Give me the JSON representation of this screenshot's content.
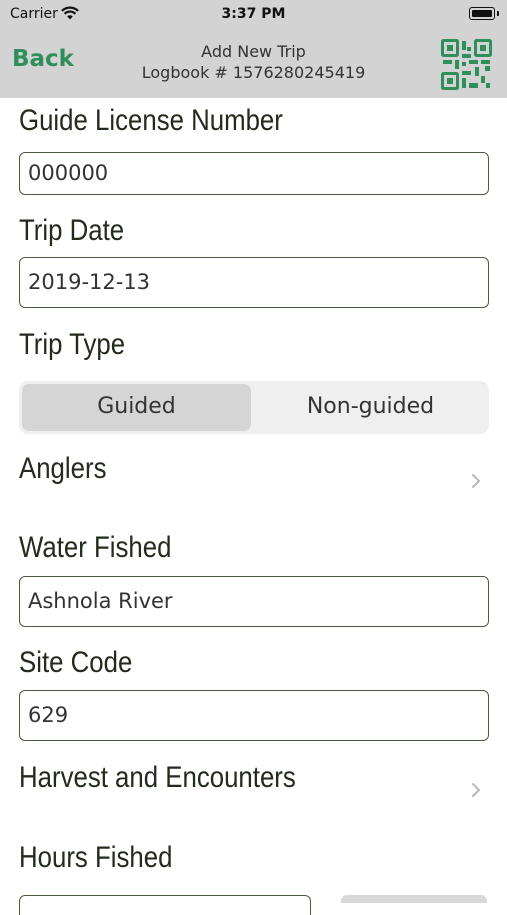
{
  "status_bar": {
    "carrier": "Carrier",
    "time": "3:37 PM"
  },
  "nav": {
    "back_label": "Back",
    "title": "Add New Trip",
    "subtitle": "Logbook # 1576280245419",
    "qr_icon": "qr-code-icon"
  },
  "form": {
    "guide_license": {
      "label": "Guide License Number",
      "value": "000000"
    },
    "trip_date": {
      "label": "Trip Date",
      "value": "2019-12-13"
    },
    "trip_type": {
      "label": "Trip Type",
      "options": [
        "Guided",
        "Non-guided"
      ],
      "selected": "Guided"
    },
    "anglers": {
      "label": "Anglers"
    },
    "water_fished": {
      "label": "Water Fished",
      "value": "Ashnola River"
    },
    "site_code": {
      "label": "Site Code",
      "value": "629"
    },
    "harvest": {
      "label": "Harvest and Encounters"
    },
    "hours_fished": {
      "label": "Hours Fished"
    }
  },
  "colors": {
    "accent": "#2f8f5a",
    "label": "#222b1e",
    "border": "#4a5a3f",
    "nav_bg": "#d3d3d3"
  }
}
